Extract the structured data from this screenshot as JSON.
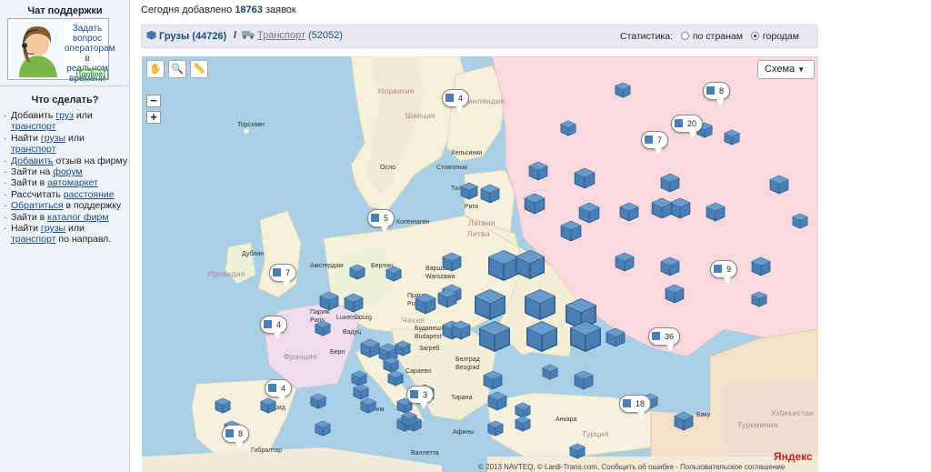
{
  "sidebar": {
    "chat_title": "Чат поддержки",
    "chat_text": "Задать вопрос операторам в реальном времени",
    "online": "[online]",
    "todo_title": "Что сделать?",
    "items": [
      {
        "pre": "Добавить ",
        "link": "груз",
        "post": " или ",
        "link2": "транспорт",
        "post2": ""
      },
      {
        "pre": "Найти ",
        "link": "грузы",
        "post": " или ",
        "link2": "транспорт",
        "post2": ""
      },
      {
        "pre": "",
        "link": "Добавить",
        "post": " отзыв на фирму",
        "link2": "",
        "post2": ""
      },
      {
        "pre": "Зайти на ",
        "link": "форум",
        "post": "",
        "link2": "",
        "post2": ""
      },
      {
        "pre": "Зайти в ",
        "link": "автомаркет",
        "post": "",
        "link2": "",
        "post2": ""
      },
      {
        "pre": "Рассчитать ",
        "link": "расстояние",
        "post": "",
        "link2": "",
        "post2": ""
      },
      {
        "pre": "",
        "link": "Обратиться",
        "post": " в поддержку",
        "link2": "",
        "post2": ""
      },
      {
        "pre": "Зайти в ",
        "link": "каталог фирм",
        "post": "",
        "link2": "",
        "post2": ""
      },
      {
        "pre": "Найти ",
        "link": "грузы",
        "post": " или ",
        "link2": "транспорт",
        "post2": " по направл."
      }
    ]
  },
  "header": {
    "added_prefix": "Сегодня добавлено",
    "added_count": "18763",
    "added_suffix": "заявок"
  },
  "tabs": {
    "cargo_label": "Грузы",
    "cargo_count": "(44726)",
    "separator": "/",
    "transport_label": "Транспорт",
    "transport_count": "(52052)",
    "stats_label": "Статистика:",
    "by_country": "по странам",
    "by_city": "городам"
  },
  "map": {
    "scheme_label": "Схема",
    "copyright": "© 2013 NAVTEQ, © Lardi-Trans.com, Сообщить об ошибке · Пользовательское соглашение",
    "logo": "Яндекс",
    "countries": [
      "Норвегия",
      "Финляндия",
      "Швеция",
      "Латвия",
      "Литва",
      "Ирландия",
      "Чехия",
      "Франция",
      "Турция",
      "Туркмения",
      "Узбекистан"
    ],
    "cities": [
      "Торсхавн",
      "Осло",
      "Стокгольм",
      "Хельсинки",
      "Таллин",
      "Рига",
      "Копенгаген",
      "Дублин",
      "Амстердам",
      "Берлин",
      "Варшава",
      "Warszawa",
      "Прага",
      "Praha",
      "Париж",
      "Paris",
      "Luxembourg",
      "Вадуц",
      "Берн",
      "Будапешт",
      "Budapest",
      "Загреб",
      "Белград",
      "Beograd",
      "Сараево",
      "Тирана",
      "Рим",
      "Мадрид",
      "Гибралтар",
      "Афины",
      "Анкара",
      "Валлетта",
      "Баку"
    ],
    "bubbles": [
      {
        "count": "4"
      },
      {
        "count": "8"
      },
      {
        "count": "20"
      },
      {
        "count": "7"
      },
      {
        "count": "5"
      },
      {
        "count": "7"
      },
      {
        "count": "9"
      },
      {
        "count": "4"
      },
      {
        "count": "36"
      },
      {
        "count": "4"
      },
      {
        "count": "3"
      },
      {
        "count": "18"
      },
      {
        "count": "8"
      }
    ]
  }
}
